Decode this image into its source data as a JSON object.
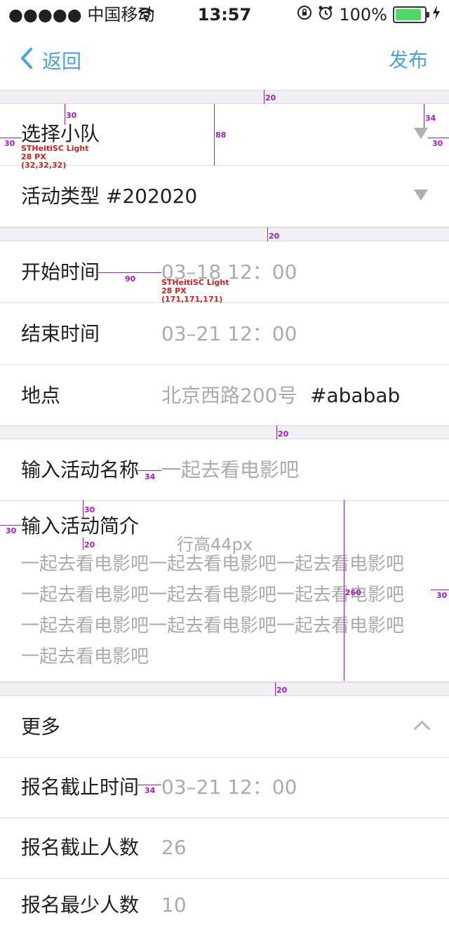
{
  "status_bar": {
    "carrier": "●●●●● 中国移动",
    "time": "13:57",
    "battery_percent": "100%",
    "battery_level": 1.0,
    "icons": [
      "wifi-icon",
      "orientation-lock-icon",
      "alarm-icon",
      "battery-icon",
      "charging-icon"
    ]
  },
  "nav": {
    "back_label": "返回",
    "publish_label": "发布"
  },
  "form": {
    "team": {
      "label": "选择小队"
    },
    "type": {
      "label": "活动类型 #202020"
    },
    "start": {
      "label": "开始时间",
      "value": "03–18 12：00"
    },
    "end": {
      "label": "结束时间",
      "value": "03–21 12：00"
    },
    "location": {
      "label": "地点",
      "value": "北京西路200号",
      "note": "#ababab"
    },
    "name": {
      "label": "输入活动名称",
      "value": "一起去看电影吧"
    },
    "intro": {
      "label": "输入活动简介",
      "line_height_note": "行高44px",
      "lines": [
        "一起去看电影吧一起去看电影吧一起去看电影吧",
        "一起去看电影吧一起去看电影吧一起去看电影吧",
        "一起去看电影吧一起去看电影吧一起去看电影吧",
        "一起去看电影吧"
      ]
    },
    "more": {
      "label": "更多"
    },
    "deadline": {
      "label": "报名截止时间",
      "value": "03–21 12：00"
    },
    "max": {
      "label": "报名截止人数",
      "value": "26"
    },
    "min": {
      "label": "报名最少人数",
      "value": "10"
    }
  },
  "annotations": {
    "gap20": "20",
    "v30": "30",
    "h30": "30",
    "row88": "88",
    "tri34": "34",
    "gap90": "90",
    "gap34": "34",
    "h260": "260",
    "font_label": {
      "name": "STHeitiSC Light",
      "size": "28 PX",
      "rgb": "(32,32,32)"
    },
    "font_value": {
      "name": "STHeitiSC Light",
      "size": "28 PX",
      "rgb": "(171,171,171)"
    }
  },
  "colors": {
    "accent": "#4aa3df",
    "text": "#202020",
    "placeholder": "#ababab",
    "section_bg": "#efeff4",
    "annotation": "#a020c0"
  }
}
